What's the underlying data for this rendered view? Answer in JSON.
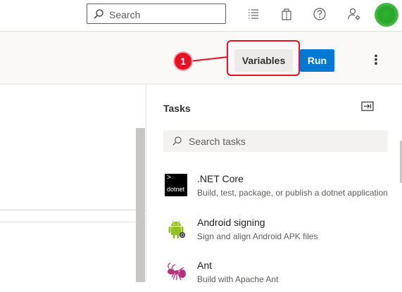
{
  "header": {
    "search_placeholder": "Search",
    "icons": [
      "search-icon",
      "list-icon",
      "marketplace-bag-icon",
      "help-icon",
      "user-settings-icon"
    ],
    "avatar_color": "#29a629"
  },
  "toolbar": {
    "variables_label": "Variables",
    "run_label": "Run",
    "more_label": "⋮",
    "callout_number": "1",
    "highlight_color": "#e81123",
    "run_color": "#0078d4"
  },
  "tasks": {
    "title": "Tasks",
    "search_placeholder": "Search tasks",
    "items": [
      {
        "name": ".NET Core",
        "description": "Build, test, package, or publish a dotnet application",
        "icon": "dotnet-icon",
        "icon_text": "dotnet"
      },
      {
        "name": "Android signing",
        "description": "Sign and align Android APK files",
        "icon": "android-icon"
      },
      {
        "name": "Ant",
        "description": "Build with Apache Ant",
        "icon": "ant-icon"
      }
    ]
  }
}
